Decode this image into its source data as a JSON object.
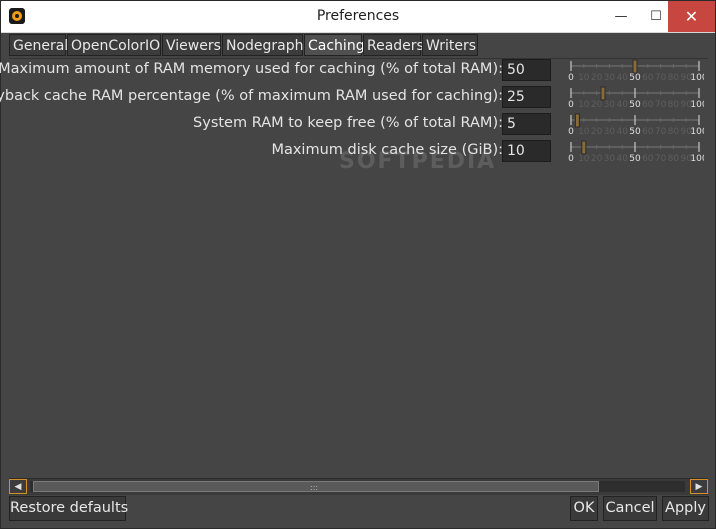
{
  "window": {
    "title": "Preferences",
    "icon": "natron-logo-icon",
    "controls": {
      "minimize": "—",
      "maximize": "☐",
      "close": "✕"
    }
  },
  "tabs": [
    {
      "label": "General",
      "active": false
    },
    {
      "label": "OpenColorIO",
      "active": false
    },
    {
      "label": "Viewers",
      "active": false
    },
    {
      "label": "Nodegraph",
      "active": false
    },
    {
      "label": "Caching",
      "active": true
    },
    {
      "label": "Readers",
      "active": false
    },
    {
      "label": "Writers",
      "active": false
    }
  ],
  "settings": [
    {
      "label": "Maximum amount of RAM memory used for caching (% of total RAM):",
      "value": "50",
      "fraction": 0.5
    },
    {
      "label": "Playback cache RAM percentage (% of maximum RAM used for caching):",
      "value": "25",
      "fraction": 0.25
    },
    {
      "label": "System RAM to keep free (% of total RAM):",
      "value": "5",
      "fraction": 0.05
    },
    {
      "label": "Maximum disk cache size (GiB):",
      "value": "10",
      "fraction": 0.1
    }
  ],
  "slider_ticks": [
    "0",
    "10",
    "20",
    "30",
    "40",
    "50",
    "60",
    "70",
    "80",
    "90",
    "100"
  ],
  "watermark": "SOFTPEDIA",
  "scrollbar": {
    "left_arrow": "◀",
    "right_arrow": "▶",
    "grip": ":::"
  },
  "buttons": {
    "restore": "Restore defaults",
    "ok": "OK",
    "cancel": "Cancel",
    "apply": "Apply"
  },
  "colors": {
    "accent": "#d88f2a",
    "background": "#454545",
    "field": "#2a2a2a",
    "text": "#e4e4e4"
  }
}
